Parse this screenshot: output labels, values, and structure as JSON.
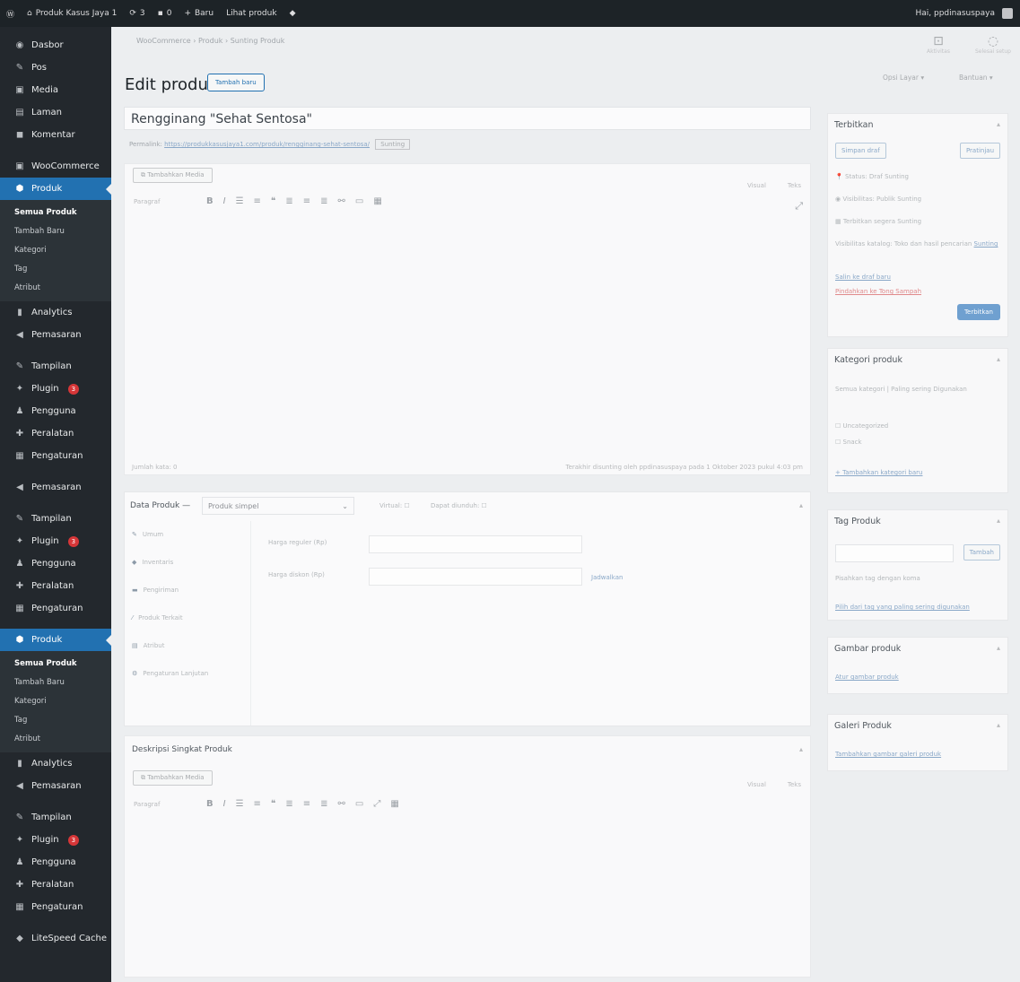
{
  "adminbar": {
    "site_name": "Produk Kasus Jaya 1",
    "updates_count": "3",
    "comments_count": "0",
    "new_label": "Baru",
    "view_product": "Lihat produk",
    "user_greeting": "Hai, ppdinasuspaya"
  },
  "sidebar": {
    "top_items": [
      {
        "icon": "dashboard-icon",
        "glyph": "◉",
        "label": "Dasbor"
      },
      {
        "icon": "pin-icon",
        "glyph": "✎",
        "label": "Pos"
      },
      {
        "icon": "media-icon",
        "glyph": "▣",
        "label": "Media"
      },
      {
        "icon": "page-icon",
        "glyph": "▤",
        "label": "Laman"
      },
      {
        "icon": "comment-icon",
        "glyph": "◼",
        "label": "Komentar"
      }
    ],
    "woocommerce": "WooCommerce",
    "produk": "Produk",
    "submenu": [
      "Semua Produk",
      "Tambah Baru",
      "Kategori",
      "Tag",
      "Atribut"
    ],
    "mid_items": [
      {
        "icon": "analytics-icon",
        "glyph": "▮",
        "label": "Analytics"
      },
      {
        "icon": "marketing-icon",
        "glyph": "◀",
        "label": "Pemasaran"
      }
    ],
    "tail_items": [
      {
        "icon": "appearance-icon",
        "glyph": "✎",
        "label": "Tampilan",
        "badge": ""
      },
      {
        "icon": "plugin-icon",
        "glyph": "✦",
        "label": "Plugin",
        "badge": "3"
      },
      {
        "icon": "users-icon",
        "glyph": "♟",
        "label": "Pengguna",
        "badge": ""
      },
      {
        "icon": "tools-icon",
        "glyph": "✚",
        "label": "Peralatan",
        "badge": ""
      },
      {
        "icon": "settings-icon",
        "glyph": "▦",
        "label": "Pengaturan",
        "badge": ""
      }
    ],
    "litespeed": "LiteSpeed Cache"
  },
  "main": {
    "breadcrumb": "WooCommerce  ›  Produk  ›  Sunting Produk",
    "activity": "Aktivitas",
    "finish_setup": "Selesai setup",
    "title": "Edit produk",
    "add_new": "Tambah baru",
    "screen_options": "Opsi Layar ▾",
    "help": "Bantuan ▾",
    "product_name": "Rengginang \"Sehat Sentosa\"",
    "permalink_label": "Permalink:",
    "permalink_url": "https://produkkasusjaya1.com/produk/rengginang-sehat-sentosa/",
    "permalink_edit": "Sunting",
    "add_media": "Tambahkan Media",
    "tab_visual": "Visual",
    "tab_text": "Teks",
    "format_select": "Paragraf",
    "word_count": "Jumlah kata: 0",
    "last_edited": "Terakhir disunting oleh ppdinasuspaya pada 1 Oktober 2023 pukul 4:03 pm",
    "product_data_label": "Data Produk —",
    "product_type": "Produk simpel",
    "virtual_label": "Virtual:",
    "downloadable_label": "Dapat diunduh:",
    "tabs": [
      {
        "icon": "wrench-icon",
        "glyph": "✎",
        "label": "Umum"
      },
      {
        "icon": "inventory-icon",
        "glyph": "◆",
        "label": "Inventaris"
      },
      {
        "icon": "shipping-icon",
        "glyph": "▬",
        "label": "Pengiriman"
      },
      {
        "icon": "linked-icon",
        "glyph": "⁄",
        "label": "Produk Terkait"
      },
      {
        "icon": "attributes-icon",
        "glyph": "▤",
        "label": "Atribut"
      },
      {
        "icon": "advanced-icon",
        "glyph": "⚙",
        "label": "Pengaturan Lanjutan"
      }
    ],
    "regular_price_label": "Harga reguler (Rp)",
    "sale_price_label": "Harga diskon (Rp)",
    "schedule_label": "Jadwalkan",
    "short_desc_label": "Deskripsi Singkat Produk",
    "short_desc_format": "Paragraf"
  },
  "right": {
    "publish_title": "Terbitkan",
    "save_draft": "Simpan draf",
    "preview": "Pratinjau",
    "status": "Status: Draf Sunting",
    "visibility": "Visibilitas: Publik Sunting",
    "publish_date": "Terbitkan segera Sunting",
    "catalog": "Visibilitas katalog: Toko dan hasil pencarian",
    "catalog_edit": "Sunting",
    "copy_draft": "Salin ke draf baru",
    "trash": "Pindahkan ke Tong Sampah",
    "publish_btn": "Terbitkan",
    "cat_title": "Kategori produk",
    "cat_tab_all": "Semua kategori",
    "cat_tab_used": "Paling sering Digunakan",
    "cat_items": [
      "Uncategorized",
      "Snack"
    ],
    "add_category": "+ Tambahkan kategori baru",
    "tag_title": "Tag Produk",
    "tag_add": "Tambah",
    "tag_hint": "Pisahkan tag dengan koma",
    "tag_choose": "Pilih dari tag yang paling sering digunakan",
    "image_title": "Gambar produk",
    "image_link": "Atur gambar produk",
    "gallery_title": "Galeri Produk",
    "gallery_link": "Tambahkan gambar galeri produk"
  }
}
